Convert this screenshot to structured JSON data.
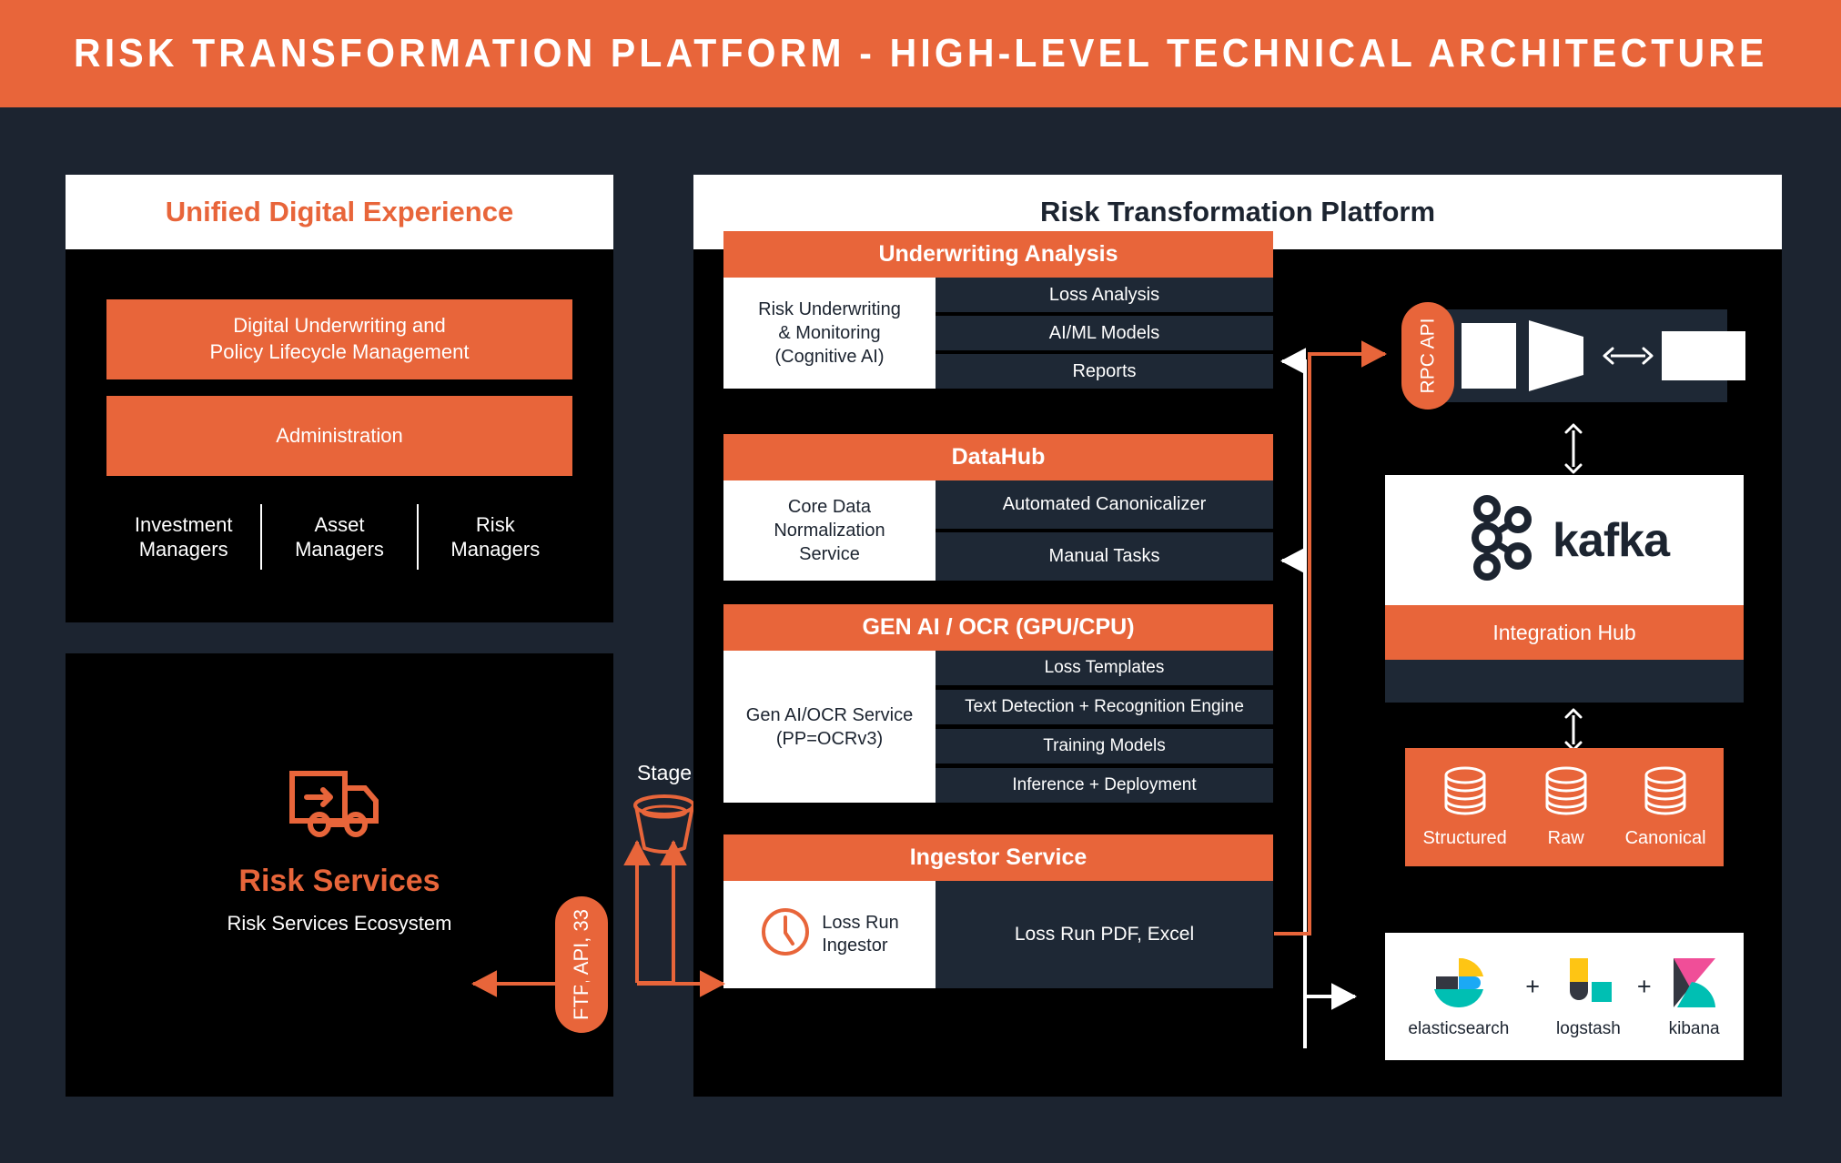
{
  "header": {
    "title": "Risk Transformation Platform - High-Level Technical Architecture"
  },
  "left_panel": {
    "title": "Unified Digital Experience",
    "bars": [
      {
        "label": "Digital Underwriting and\nPolicy Lifecycle Management"
      },
      {
        "label": "Administration"
      }
    ],
    "roles": [
      {
        "label": "Investment\nManagers"
      },
      {
        "label": "Asset\nManagers"
      },
      {
        "label": "Risk\nManagers"
      }
    ]
  },
  "risk_services": {
    "icon": "delivery-truck-icon",
    "title": "Risk Services",
    "subtitle": "Risk Services Ecosystem"
  },
  "stage": {
    "label": "Stage",
    "icon": "bucket-icon"
  },
  "ftp_pill": {
    "label": "FTP, API, 33"
  },
  "rpc_pill": {
    "label": "RPC API"
  },
  "platform": {
    "title": "Risk Transformation Platform",
    "blocks": [
      {
        "title": "Underwriting Analysis",
        "left_label": "Risk Underwriting\n& Monitoring\n(Cognitive AI)",
        "rows": [
          "Loss Analysis",
          "AI/ML Models",
          "Reports"
        ]
      },
      {
        "title": "DataHub",
        "left_label": "Core Data\nNormalization\nService",
        "rows": [
          "Automated Canonicalizer",
          "Manual Tasks"
        ]
      },
      {
        "title": "GEN AI / OCR (GPU/CPU)",
        "left_label": "Gen AI/OCR Service\n(PP=OCRv3)",
        "rows": [
          "Loss Templates",
          "Text Detection + Recognition Engine",
          "Training Models",
          "Inference + Deployment"
        ]
      },
      {
        "title": "Ingestor Service",
        "left_label": "Loss Run\nIngestor",
        "left_icon": "clock-icon",
        "rows": [
          "Loss Run PDF, Excel"
        ]
      }
    ]
  },
  "right_column": {
    "processing_bar": {
      "shapes": [
        "white-rectangle",
        "white-funnel",
        "bidirectional-arrow",
        "white-rectangle"
      ]
    },
    "kafka": {
      "wordmark": "kafka",
      "logo": "kafka-logo",
      "caption": "Integration Hub"
    },
    "data_stores": [
      {
        "label": "Structured",
        "icon": "database-icon"
      },
      {
        "label": "Raw",
        "icon": "database-icon"
      },
      {
        "label": "Canonical",
        "icon": "database-icon"
      }
    ],
    "elk_stack": [
      {
        "label": "elasticsearch",
        "icon": "elasticsearch-logo"
      },
      {
        "separator": "+"
      },
      {
        "label": "logstash",
        "icon": "logstash-logo"
      },
      {
        "separator": "+"
      },
      {
        "label": "kibana",
        "icon": "kibana-logo"
      }
    ]
  },
  "colors": {
    "accent_orange": "#e8653a",
    "background_navy": "#1c2430",
    "panel_black": "#000000",
    "row_navy": "#1e2835",
    "white": "#ffffff"
  }
}
